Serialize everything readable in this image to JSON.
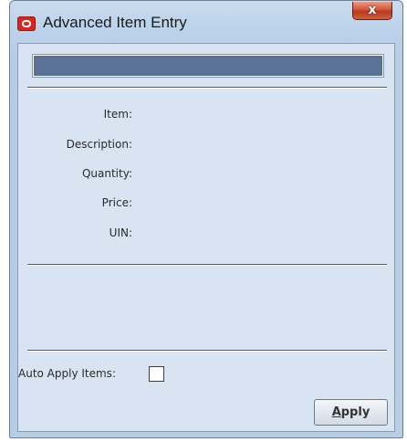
{
  "window": {
    "title": "Advanced Item Entry",
    "close_label": "x"
  },
  "progress": {
    "fraction": 1.0
  },
  "fields": [
    {
      "label": "Item:"
    },
    {
      "label": "Description:"
    },
    {
      "label": "Quantity:"
    },
    {
      "label": "Price:"
    },
    {
      "label": "UIN:"
    }
  ],
  "auto_apply": {
    "label": "Auto Apply Items:",
    "checked": false
  },
  "apply_button": {
    "mnemonic": "A",
    "rest": "pply"
  },
  "icons": {
    "app": "oracle-logo-icon",
    "close": "close-icon"
  },
  "colors": {
    "progress_fill": "#5a7298",
    "close_button": "#c9472b",
    "panel_background": "#d8e4f1"
  }
}
